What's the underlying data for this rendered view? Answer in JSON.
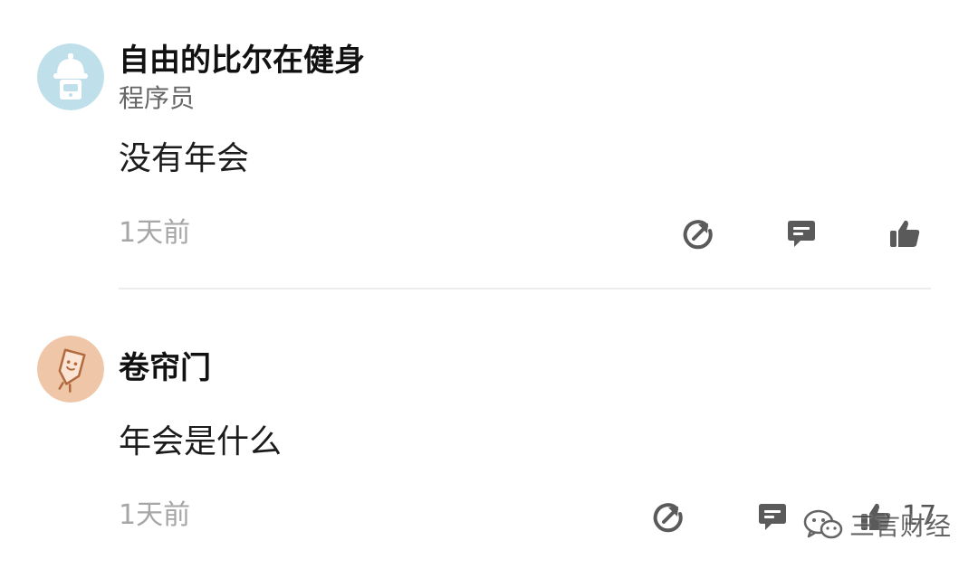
{
  "posts": [
    {
      "username": "自由的比尔在健身",
      "job": "程序员",
      "content": "没有年会",
      "time": "1天前",
      "avatar_icon": "helmet-robot-avatar",
      "avatar_bg": "#bfe0ea"
    },
    {
      "username": "卷帘门",
      "content": "年会是什么",
      "time": "1天前",
      "like_count": "17",
      "avatar_icon": "shield-mascot-avatar",
      "avatar_bg": "#f0c6a8"
    }
  ],
  "icons": {
    "share": "share-icon",
    "comment": "comment-icon",
    "like": "thumbs-up-icon"
  },
  "watermark": {
    "text": "三言财经",
    "icon": "wechat-icon"
  },
  "colors": {
    "text_primary": "#111111",
    "text_secondary": "#666666",
    "text_muted": "#a6a6a6",
    "icon": "#5a5a5a",
    "divider": "#ececec"
  }
}
